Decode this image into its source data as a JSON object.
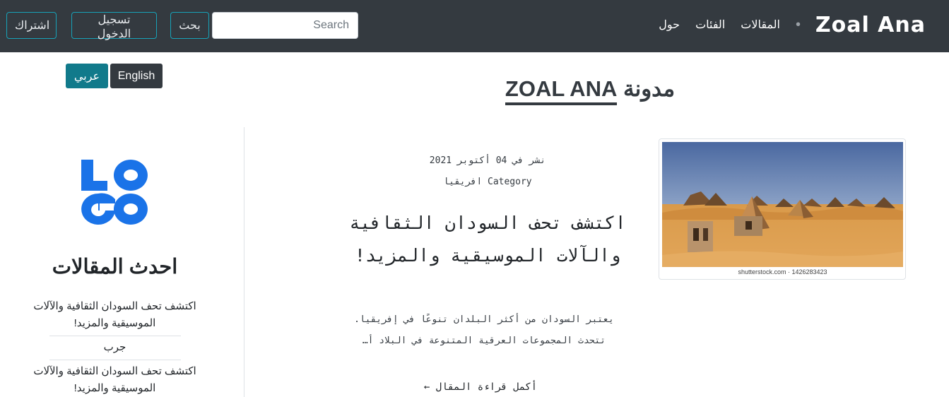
{
  "navbar": {
    "brand": "Zoal Ana",
    "links": [
      "المقالات",
      "الفئات",
      "حول"
    ],
    "search_placeholder": "Search",
    "search_button": "بحث",
    "login_button": "تسجيل الدخول",
    "signup_button": "اشتراك"
  },
  "language": {
    "english": "English",
    "arabic": "عربي"
  },
  "page": {
    "title_prefix": "مدونة",
    "title_brand": "ZOAL ANA"
  },
  "post": {
    "date": "نشر في 04 أكتوبر 2021",
    "category": "Category افريقيا",
    "title": "اكتشف تحف السودان الثقافية والآلات الموسيقية والمزيد!",
    "excerpt": "يعتبر السودان من أكثر البلدان تنوعًا في إفريقيا. تتحدث المجموعات العرقية المتنوعة في البلاد أ…",
    "read_more": "أكمل قراءة المقال ←",
    "image_credit": "shutterstock.com · 1426283423"
  },
  "sidebar": {
    "logo_text": "LOGO",
    "title": "احدث المقالات",
    "items": [
      "اكتشف تحف السودان الثقافية والآلات الموسيقية والمزيد!",
      "جرب",
      "اكتشف تحف السودان الثقافية والآلات الموسيقية والمزيد!"
    ]
  },
  "colors": {
    "navbar_bg": "#343a40",
    "accent_teal": "#17a2b8",
    "arabic_button": "#117a8b",
    "logo_blue": "#1a73e8"
  }
}
